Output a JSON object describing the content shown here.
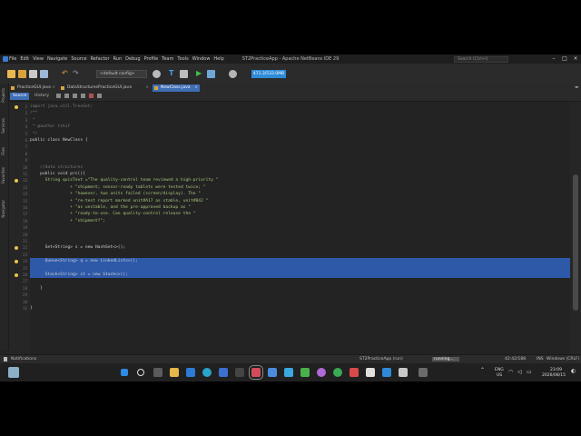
{
  "window": {
    "title": "ST2PracticeApp - Apache NetBeans IDE 29",
    "search_placeholder": "Search (Ctrl+I)"
  },
  "menu": [
    "File",
    "Edit",
    "View",
    "Navigate",
    "Source",
    "Refactor",
    "Run",
    "Debug",
    "Profile",
    "Team",
    "Tools",
    "Window",
    "Help"
  ],
  "toolbar": {
    "config": "<default config>",
    "memory": "471.3/533.0MB"
  },
  "side_panels": [
    "Projects",
    "Services",
    "Files",
    "Navigator",
    "Favorites"
  ],
  "tabs": [
    {
      "label": "PracticeGUI.java",
      "active": false
    },
    {
      "label": "DataStructuresPracticeGUI.java",
      "active": false
    },
    {
      "label": "NewClass.java",
      "active": true
    }
  ],
  "editor": {
    "source_tab": "Source",
    "history_tab": "History"
  },
  "code_lines": [
    {
      "n": "1",
      "text": "import java.util.TreeSet;",
      "cls": "cm"
    },
    {
      "n": "2",
      "text": "/**",
      "cls": "cm"
    },
    {
      "n": "3",
      "text": " *",
      "cls": "cm"
    },
    {
      "n": "4",
      "text": " * @author tshif",
      "cls": "cm"
    },
    {
      "n": "5",
      "text": " */",
      "cls": "cm"
    },
    {
      "n": "6",
      "text": "public class NewClass {",
      "cls": ""
    },
    {
      "n": "7",
      "text": "",
      "cls": ""
    },
    {
      "n": "8",
      "text": "",
      "cls": ""
    },
    {
      "n": "9",
      "text": "",
      "cls": ""
    },
    {
      "n": "10",
      "text": "    //data structures",
      "cls": "cm"
    },
    {
      "n": "11",
      "text": "    public void prc(){",
      "cls": ""
    },
    {
      "n": "12",
      "text": "      String quizText =\"The quality-control team reviewed a high-priority \"",
      "cls": "st"
    },
    {
      "n": "13",
      "text": "                + \"shipment; sensor-ready tablets were tested twice; \"",
      "cls": "st"
    },
    {
      "n": "14",
      "text": "                + \"however, two units failed (screen/display). The \"",
      "cls": "st"
    },
    {
      "n": "15",
      "text": "                + \"re-test report marked unit#A17 as stable, unit#B42 \"",
      "cls": "st"
    },
    {
      "n": "16",
      "text": "                + \"as unstable, and the pre-approved backup as \"",
      "cls": "st"
    },
    {
      "n": "17",
      "text": "                + \"ready-to-use. Can quality-control release the \"",
      "cls": "st"
    },
    {
      "n": "18",
      "text": "                + \"shipment?\";",
      "cls": "st"
    },
    {
      "n": "19",
      "text": "",
      "cls": ""
    },
    {
      "n": "20",
      "text": "",
      "cls": ""
    },
    {
      "n": "21",
      "text": "",
      "cls": ""
    },
    {
      "n": "22",
      "text": "      Set<String> s = new HashSet<>();",
      "cls": ""
    },
    {
      "n": "23",
      "text": "",
      "cls": ""
    },
    {
      "n": "24",
      "text": "      Queue<String> q = new LinkedList<>();",
      "cls": "",
      "hl": true
    },
    {
      "n": "25",
      "text": "",
      "cls": "",
      "hl": true
    },
    {
      "n": "26",
      "text": "      Stack<String> st = new Stack<>();",
      "cls": "",
      "hl": true
    },
    {
      "n": "27",
      "text": "",
      "cls": ""
    },
    {
      "n": "28",
      "text": "    }",
      "cls": ""
    },
    {
      "n": "29",
      "text": "",
      "cls": ""
    },
    {
      "n": "30",
      "text": "",
      "cls": ""
    },
    {
      "n": "31",
      "text": "}",
      "cls": ""
    }
  ],
  "status": {
    "notifications": "Notifications",
    "project_run": "ST2PracticeApp (run)",
    "running": "running...",
    "position": "42:42/188",
    "mode": "INS",
    "line_ending": "Windows (CRLF)"
  },
  "tray": {
    "lang": "ENG",
    "region": "US",
    "time": "23:09",
    "date": "2026/08/15"
  }
}
